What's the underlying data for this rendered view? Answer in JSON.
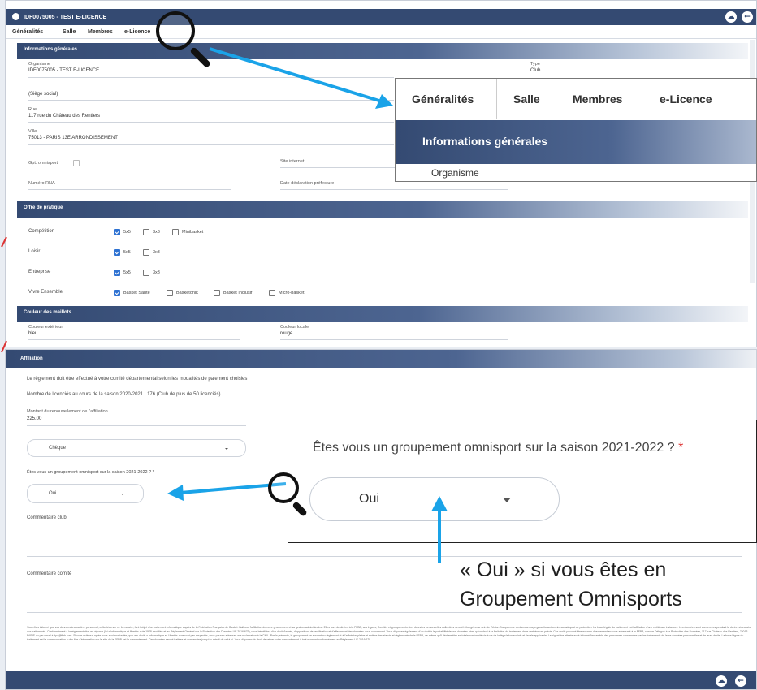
{
  "top_panel": {
    "window_title": "IDF0075005 - TEST E-LICENCE",
    "tabs": [
      "Généralités",
      "Salle",
      "Membres",
      "e-Licence"
    ],
    "general_section": "Informations générales",
    "organisme_label": "Organisme",
    "organisme_value": "IDF0075005 - TEST E-LICENCE",
    "type_label": "Type",
    "type_value": "Club",
    "siege_social": "(Siège social)",
    "rue_label": "Rue",
    "rue_value": "117 rue du Château des Rentiers",
    "ville_label": "Ville",
    "ville_value": "75013 - PARIS 13E ARRONDISSEMENT",
    "gpt_omnisport_label": "Gpt. omnisport",
    "site_internet_label": "Site internet",
    "numero_rna_label": "Numéro RNA",
    "date_declaration_label": "Date déclaration préfecture",
    "offre_section": "Offre de pratique",
    "offre_rows": [
      {
        "label": "Compétition",
        "options": [
          {
            "text": "5x5",
            "checked": true
          },
          {
            "text": "3x3",
            "checked": false
          },
          {
            "text": "Minibasket",
            "checked": false
          }
        ]
      },
      {
        "label": "Loisir",
        "options": [
          {
            "text": "5x5",
            "checked": true
          },
          {
            "text": "3x3",
            "checked": false
          }
        ]
      },
      {
        "label": "Entreprise",
        "options": [
          {
            "text": "5x5",
            "checked": true
          },
          {
            "text": "3x3",
            "checked": false
          }
        ]
      },
      {
        "label": "Vivre Ensemble",
        "options": [
          {
            "text": "Basket Santé",
            "checked": true
          },
          {
            "text": "Basketonik",
            "checked": false
          },
          {
            "text": "Basket Inclusif",
            "checked": false
          },
          {
            "text": "Micro-basket",
            "checked": false
          }
        ]
      }
    ],
    "maillots_section": "Couleur des maillots",
    "couleur_exterieur_label": "Couleur extérieur",
    "couleur_exterieur_value": "bleu",
    "couleur_locale_label": "Couleur locale",
    "couleur_locale_value": "rouge"
  },
  "zoom_tabs": {
    "tabs": [
      "Généralités",
      "Salle",
      "Membres",
      "e-Licence"
    ],
    "section": "Informations générales",
    "field": "Organisme"
  },
  "bottom_panel": {
    "section": "Affiliation",
    "reglement_text": "Le règlement doit être effectué à votre comité départemental selon les modalités de paiement choisies",
    "licences_text": "Nombre de licenciés au cours de la saison 2020-2021 : 176 (Club de plus de 50 licenciés)",
    "montant_label": "Montant du renouvellement de l'affiliation",
    "montant_value": "225.00",
    "payment_select": "Chèque",
    "omnisport_question": "Êtes vous un groupement omnisport sur la saison 2021-2022 ? *",
    "omnisport_select": "Oui",
    "commentaire_club_label": "Commentaire club",
    "commentaire_comite_label": "Commentaire comité",
    "legal_text": "Vous êtes informé que vos données à caractère personnel, collectées sur ce formulaire, font l'objet d'un traitement informatique auprès de la Fédération Française de Basket. Ballpour l'affiliation de votre groupement et sa gestion administrative. Elles sont destinées à la FFBB, ses Ligues, Comités et groupements. Les données personnelles collectées seront hébergées au sein de l'Union Européenne ou dans un pays garantissant un niveau adéquat de protection. La base légale du traitement est l'affiliation d'une entité aux instances. Les données sont conservées pendant la durée nécessaire aux traitements. Conformément à la réglementation en vigueur (loi « Informatique et libertés » de 1978 modifiée et au Règlement Général sur la Protection des Données UE 2016/679), vous bénéficiez d'un droit d'accès, d'opposition, de rectification et d'effacement des données vous concernant. Vous disposez également d'un droit à la portabilité de vos données ainsi qu'un droit à la limitation du traitement dans certains cas précis. Ces droits peuvent être exercés directement en vous adressant à la FFBB, service Délégué à la Protection des Données, 117 rue Château des Rentiers, 75013 PARIS ou par email à dpo@ffbb.com. Si vous estimez, après nous avoir contactés, que vos droits « Informatique et Libertés » ne sont pas respectés, vous pouvez adresser une réclamation à la CNIL. Par la présente, le groupement se soumet au règlement et à l'adhésion pleine et entière des statuts et règlements de la FFBB, de même qu'il déclare être en totale conformité vis à vis de la législation sociale et fiscale applicable. Le signataire atteste avoir informé l'ensemble des personnes concernées par les traitements de leurs données personnelles et de leurs droits. La base légale du traitement est la communication à des fins d'information sur le site de la FFBB est le consentement. Ces données seront traitées et conservées jusqu'au retrait de celui-ci. Vous disposez du droit de retirer votre consentement à tout moment conformément au Règlement UE 2016/679."
  },
  "zoom_question": {
    "question": "Êtes vous un groupement omnisport sur la saison 2021-2022 ?",
    "required_mark": "*",
    "select_value": "Oui"
  },
  "annotation": {
    "line1": "« Oui » si vous êtes en",
    "line2": "Groupement Omnisports"
  },
  "icons": {
    "cloud": "cloud-upload-icon",
    "back": "arrow-left-icon"
  },
  "colors": {
    "header": "#344a72",
    "accent_arrow": "#1aa3e8",
    "checkbox": "#2e72d2"
  }
}
